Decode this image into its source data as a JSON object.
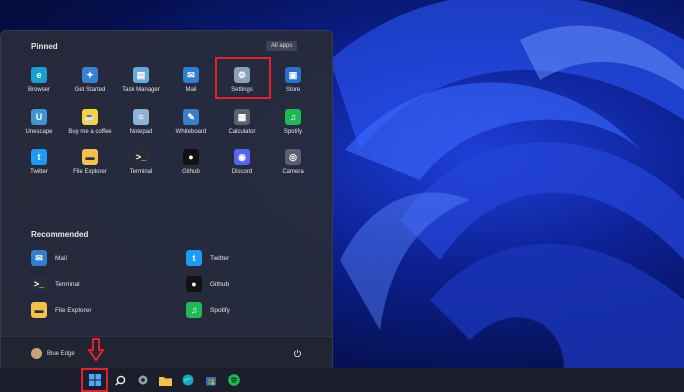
{
  "start_menu": {
    "pinned_title": "Pinned",
    "all_apps_label": "All apps",
    "pinned": [
      {
        "label": "Browser",
        "icon": "edge-icon",
        "color": "#1a9fd4"
      },
      {
        "label": "Get Started",
        "icon": "get-started-icon",
        "color": "#3a7fd6"
      },
      {
        "label": "Task Manager",
        "icon": "task-manager-icon",
        "color": "#6aa8d8"
      },
      {
        "label": "Mail",
        "icon": "mail-icon",
        "color": "#2f7fd0"
      },
      {
        "label": "Settings",
        "icon": "settings-gear-icon",
        "color": "#8aa0b8"
      },
      {
        "label": "Store",
        "icon": "store-icon",
        "color": "#2b6fc9"
      },
      {
        "label": "Unescape",
        "icon": "unescape-icon",
        "color": "#3f95cf"
      },
      {
        "label": "Buy me a coffee",
        "icon": "coffee-icon",
        "color": "#f5d53b"
      },
      {
        "label": "Notepad",
        "icon": "notepad-icon",
        "color": "#8fb3d6"
      },
      {
        "label": "Whiteboard",
        "icon": "whiteboard-icon",
        "color": "#3a7ec9"
      },
      {
        "label": "Calculator",
        "icon": "calculator-icon",
        "color": "#5b6272"
      },
      {
        "label": "Spotify",
        "icon": "spotify-icon",
        "color": "#1db954"
      },
      {
        "label": "Twitter",
        "icon": "twitter-icon",
        "color": "#1d9bf0"
      },
      {
        "label": "File Explorer",
        "icon": "folder-icon",
        "color": "#f2c14e"
      },
      {
        "label": "Terminal",
        "icon": "terminal-icon",
        "color": "#2a2d36"
      },
      {
        "label": "Github",
        "icon": "github-icon",
        "color": "#111111"
      },
      {
        "label": "Discord",
        "icon": "discord-icon",
        "color": "#5865f2"
      },
      {
        "label": "Camera",
        "icon": "camera-icon",
        "color": "#5a6070"
      }
    ],
    "recommended_title": "Recommended",
    "recommended": [
      {
        "label": "Mail",
        "icon": "mail-icon",
        "color": "#2f7fd0"
      },
      {
        "label": "Twitter",
        "icon": "twitter-icon",
        "color": "#1d9bf0"
      },
      {
        "label": "Terminal",
        "icon": "terminal-icon",
        "color": "#2a2d36"
      },
      {
        "label": "Github",
        "icon": "github-icon",
        "color": "#111111"
      },
      {
        "label": "File Explorer",
        "icon": "folder-icon",
        "color": "#f2c14e"
      },
      {
        "label": "Spotify",
        "icon": "spotify-icon",
        "color": "#1db954"
      }
    ],
    "user_name": "Blue Edge"
  },
  "taskbar": {
    "items": [
      "start-icon",
      "search-icon",
      "settings-gear-icon",
      "folder-icon",
      "edge-icon",
      "store-icon",
      "spotify-icon"
    ]
  },
  "colors": {
    "highlight": "#e0242e",
    "accent": "#2b6fd9"
  }
}
